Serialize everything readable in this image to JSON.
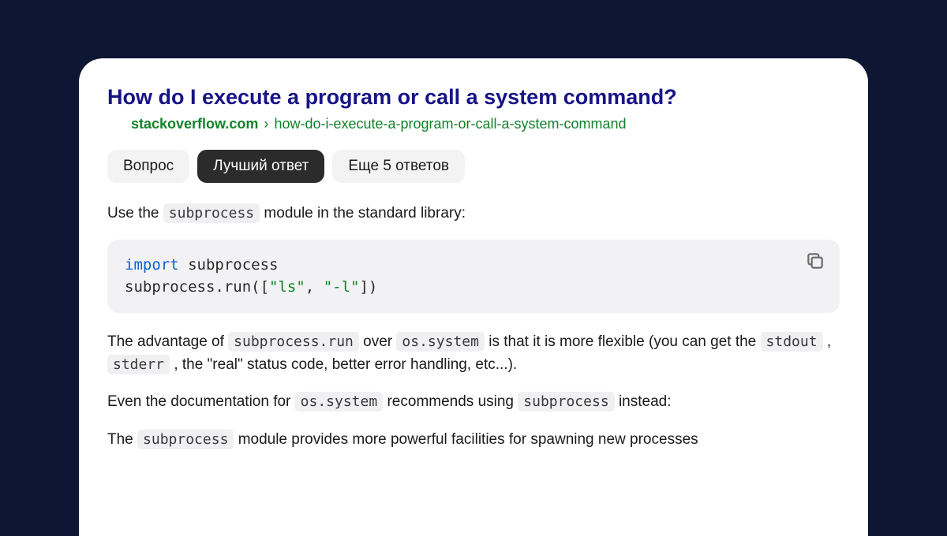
{
  "title": "How do I execute a program or call a system command?",
  "breadcrumb": {
    "domain": "stackoverflow.com",
    "separator": "›",
    "path": "how-do-i-execute-a-program-or-call-a-system-command"
  },
  "tabs": [
    {
      "label": "Вопрос",
      "active": false
    },
    {
      "label": "Лучший ответ",
      "active": true
    },
    {
      "label": "Еще 5 ответов",
      "active": false
    }
  ],
  "answer": {
    "intro_before": "Use the ",
    "intro_code": "subprocess",
    "intro_after": " module in the standard library:",
    "code": {
      "line1_kw": "import",
      "line1_rest": " subprocess",
      "line2_a": "subprocess.run([",
      "line2_s1": "\"ls\"",
      "line2_b": ", ",
      "line2_s2": "\"-l\"",
      "line2_c": "])"
    },
    "p2_a": "The advantage of ",
    "p2_c1": "subprocess.run",
    "p2_b": " over ",
    "p2_c2": "os.system",
    "p2_c": " is that it is more flexible (you can get the ",
    "p2_c3": "stdout",
    "p2_d": ", ",
    "p2_c4": "stderr",
    "p2_e": ", the \"real\" status code, better error handling, etc...).",
    "p3_a": "Even the documentation for ",
    "p3_c1": "os.system",
    "p3_b": " recommends using ",
    "p3_c2": "subprocess",
    "p3_c": " instead:",
    "p4_a": "The ",
    "p4_c1": "subprocess",
    "p4_b": " module provides more powerful facilities for spawning new processes"
  }
}
